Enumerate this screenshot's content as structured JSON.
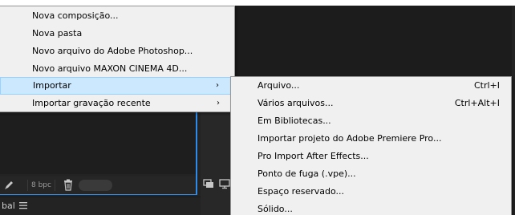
{
  "main_menu": {
    "items": [
      {
        "label": "Nova composição..."
      },
      {
        "label": "Nova pasta"
      },
      {
        "label": "Novo arquivo do Adobe Photoshop..."
      },
      {
        "label": "Novo arquivo MAXON CINEMA 4D..."
      },
      {
        "label": "Importar",
        "arrow": "›",
        "highlighted": true
      },
      {
        "label": "Importar gravação recente",
        "arrow": "›"
      }
    ]
  },
  "import_submenu": {
    "items": [
      {
        "label": "Arquivo...",
        "shortcut": "Ctrl+I"
      },
      {
        "label": "Vários arquivos...",
        "shortcut": "Ctrl+Alt+I"
      },
      {
        "label": "Em Bibliotecas..."
      },
      {
        "label": "Importar projeto do Adobe Premiere Pro..."
      },
      {
        "label": "Pro Import After Effects..."
      },
      {
        "label": "Ponto de fuga (.vpe)..."
      },
      {
        "label": "Espaço reservado..."
      },
      {
        "label": "Sólido..."
      }
    ]
  },
  "project_panel": {
    "bit_depth": "8 bpc",
    "tab_label": "bal",
    "icons": [
      "pen-icon",
      "trash-icon",
      "monitor-icon",
      "display-icon",
      "hamburger-icon"
    ]
  },
  "colors": {
    "menu_background": "#f0f0f0",
    "menu_highlight": "#cce8ff",
    "panel_background": "#232323",
    "selection_border": "#2d8ceb"
  }
}
